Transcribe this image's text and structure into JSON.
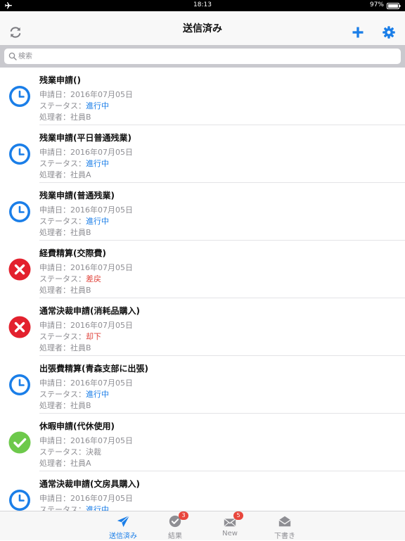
{
  "status_bar": {
    "time": "18:13",
    "battery": "97%",
    "icons": [
      "airplane-icon",
      "battery-icon"
    ]
  },
  "navbar": {
    "title": "送信済み",
    "icons": [
      "refresh-icon",
      "plus-icon",
      "gear-icon"
    ],
    "accent_color": "#1a7ee8"
  },
  "search": {
    "placeholder": "検索",
    "value": ""
  },
  "labels": {
    "date": "申請日：",
    "status": "ステータス：",
    "handler": "処理者："
  },
  "items": [
    {
      "title": "残業申請()",
      "date": "2016年07月05日",
      "status": "進行中",
      "status_color": "blue",
      "handler": "社員B",
      "icon": "clock-icon"
    },
    {
      "title": "残業申請(平日普通残業)",
      "date": "2016年07月05日",
      "status": "進行中",
      "status_color": "blue",
      "handler": "社員A",
      "icon": "clock-icon"
    },
    {
      "title": "残業申請(普通残業)",
      "date": "2016年07月05日",
      "status": "進行中",
      "status_color": "blue",
      "handler": "社員B",
      "icon": "clock-icon"
    },
    {
      "title": "経費精算(交際費)",
      "date": "2016年07月05日",
      "status": "差戻",
      "status_color": "red",
      "handler": "社員B",
      "icon": "rejected-x-icon"
    },
    {
      "title": "通常決裁申請(消耗品購入)",
      "date": "2016年07月05日",
      "status": "却下",
      "status_color": "red",
      "handler": "社員B",
      "icon": "rejected-x-icon"
    },
    {
      "title": "出張費精算(青森支部に出張)",
      "date": "2016年07月05日",
      "status": "進行中",
      "status_color": "blue",
      "handler": "社員B",
      "icon": "clock-icon"
    },
    {
      "title": "休暇申請(代休使用)",
      "date": "2016年07月05日",
      "status": "決裁",
      "status_color": "gray",
      "handler": "社員A",
      "icon": "approved-check-icon"
    },
    {
      "title": "通常決裁申請(文房具購入)",
      "date": "2016年07月05日",
      "status": "進行中",
      "status_color": "blue",
      "handler": "",
      "icon": "clock-icon"
    }
  ],
  "colors": {
    "blue": "#1a7ee8",
    "red": "#e3212e",
    "green": "#6dc94b"
  },
  "tabbar": {
    "tabs": [
      {
        "label": "送信済み",
        "icon": "send-icon",
        "active": true,
        "badge": ""
      },
      {
        "label": "結果",
        "icon": "check-circle-icon",
        "active": false,
        "badge": "3"
      },
      {
        "label": "New",
        "icon": "inbox-icon",
        "active": false,
        "badge": "5"
      },
      {
        "label": "下書き",
        "icon": "draft-tray-icon",
        "active": false,
        "badge": ""
      }
    ]
  }
}
